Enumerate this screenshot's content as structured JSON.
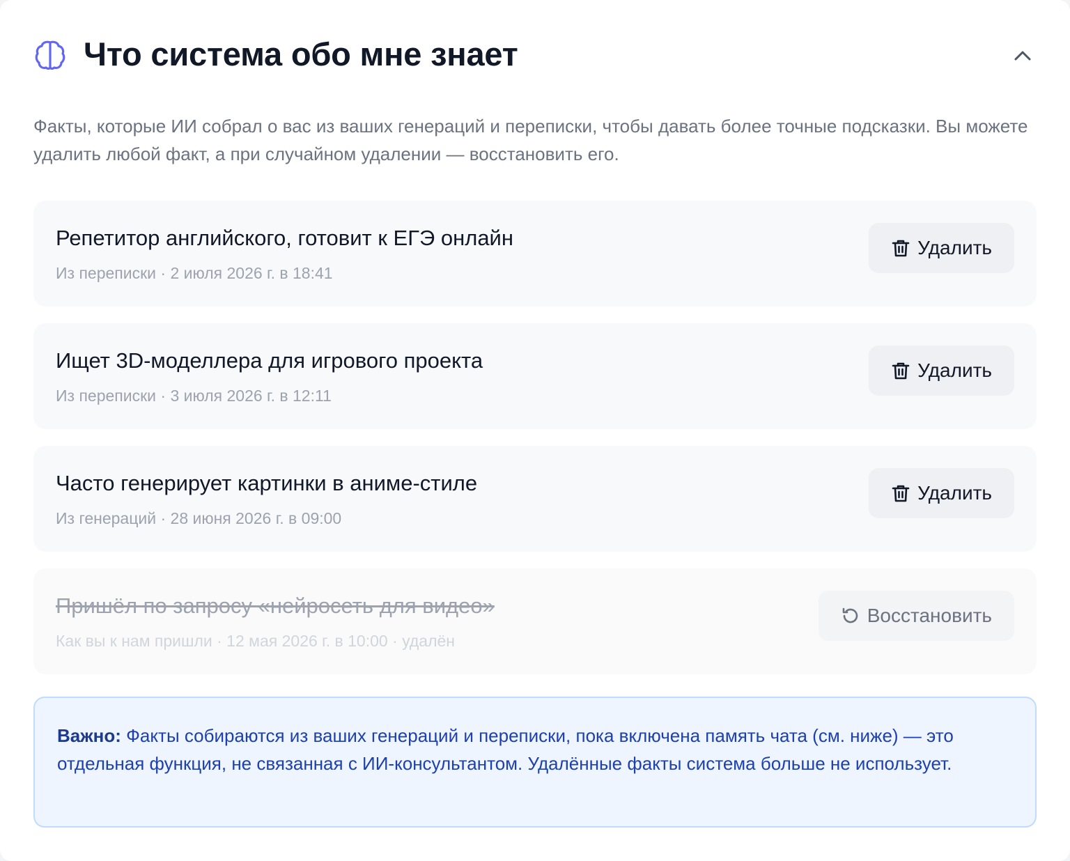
{
  "section": {
    "title": "Что система обо мне знает",
    "icon": "brain-icon",
    "collapse_icon": "chevron-up-icon",
    "description": "Факты, которые ИИ собрал о вас из ваших генераций и переписки, чтобы давать более точные подсказки. Вы можете удалить любой факт, а при случайном удалении — восстановить его.",
    "accent_color": "#6366f1"
  },
  "facts": [
    {
      "text": "Репетитор английского, готовит к ЕГЭ онлайн",
      "meta": "Из переписки · 2 июля 2026 г. в 18:41",
      "action_label": "Удалить",
      "action_icon": "trash-icon",
      "deleted": false
    },
    {
      "text": "Ищет 3D-моделлера для игрового проекта",
      "meta": "Из переписки · 3 июля 2026 г. в 12:11",
      "action_label": "Удалить",
      "action_icon": "trash-icon",
      "deleted": false
    },
    {
      "text": "Часто генерирует картинки в аниме-стиле",
      "meta": "Из генераций · 28 июня 2026 г. в 09:00",
      "action_label": "Удалить",
      "action_icon": "trash-icon",
      "deleted": false
    },
    {
      "text": "Пришёл по запросу «нейросеть для видео»",
      "meta": "Как вы к нам пришли · 12 мая 2026 г. в 10:00 · удалён",
      "action_label": "Восстановить",
      "action_icon": "restore-icon",
      "deleted": true
    }
  ],
  "notice": {
    "label": "Важно:",
    "text": "Факты собираются из ваших генераций и переписки, пока включена память чата (см. ниже) — это отдельная функция, не связанная с ИИ-консультантом. Удалённые факты система больше не использует.",
    "background": "#eef5ff",
    "border": "#bfdbfe",
    "text_color": "#1e40af"
  }
}
